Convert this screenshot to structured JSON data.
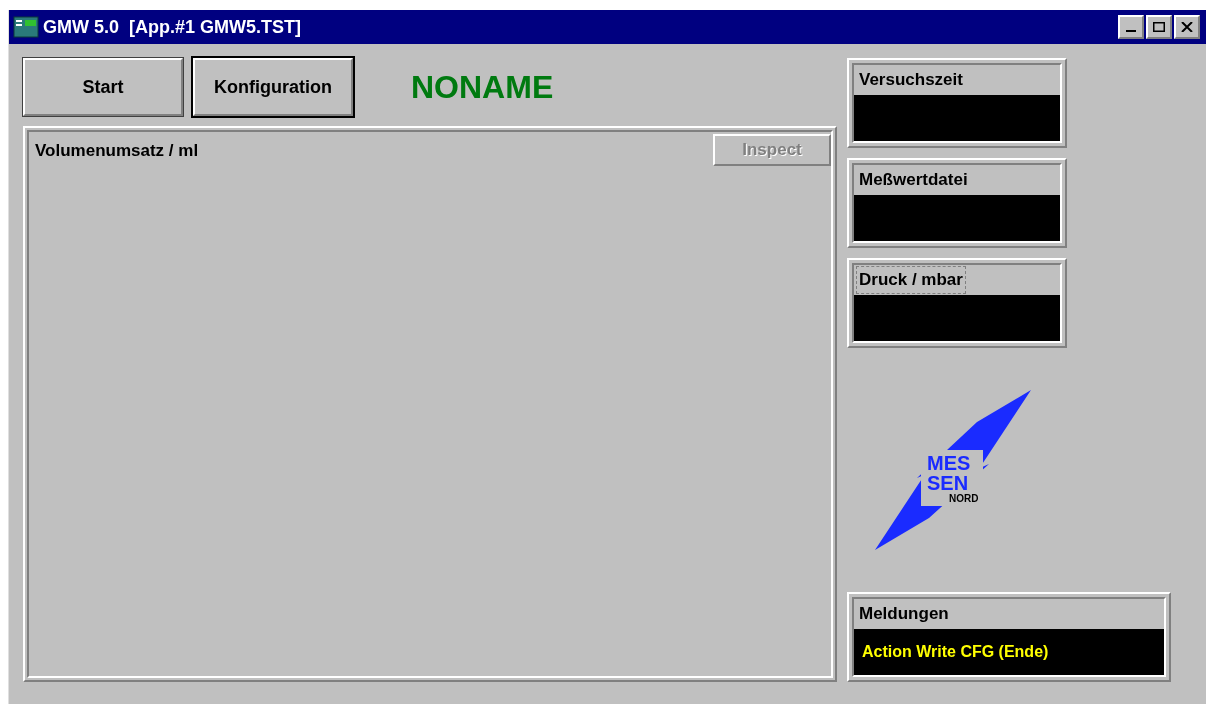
{
  "window": {
    "title": "GMW 5.0  [App.#1 GMW5.TST]"
  },
  "toolbar": {
    "buttons": [
      {
        "label": "Start",
        "default": false
      },
      {
        "label": "Konfiguration",
        "default": true
      }
    ],
    "project_name": "NONAME"
  },
  "chart_panel": {
    "title": "Volumenumsatz / ml",
    "inspect_button": {
      "label": "Inspect",
      "disabled": true
    }
  },
  "displays": [
    {
      "label": "Versuchszeit",
      "focused": false
    },
    {
      "label": "Meßwertdatei",
      "focused": false
    },
    {
      "label": "Druck / mbar",
      "focused": true
    }
  ],
  "logo": {
    "lines": [
      "MES",
      "SEN"
    ],
    "subtitle": "NORD"
  },
  "messages": {
    "label": "Meldungen",
    "text": "Action Write CFG (Ende)"
  }
}
